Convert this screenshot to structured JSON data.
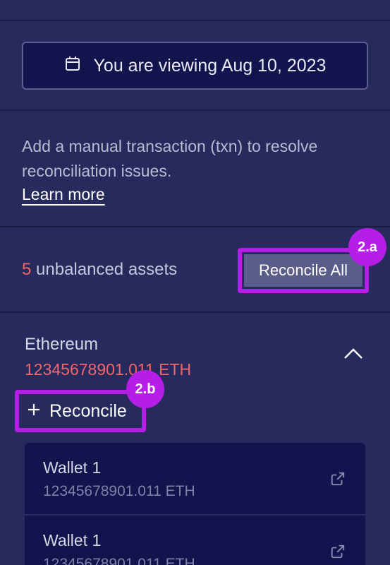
{
  "date_button": {
    "label": "You are viewing Aug 10, 2023"
  },
  "info": {
    "text": "Add a manual transaction (txn) to resolve reconciliation issues.",
    "learn_more": "Learn more"
  },
  "summary": {
    "count": "5",
    "label": "unbalanced assets",
    "reconcile_all": "Reconcile All",
    "badge": "2.a"
  },
  "asset": {
    "name": "Ethereum",
    "amount": "12345678901.011 ETH",
    "reconcile": "Reconcile",
    "badge": "2.b"
  },
  "wallets": [
    {
      "name": "Wallet 1",
      "amount": "12345678901.011 ETH"
    },
    {
      "name": "Wallet 1",
      "amount": "12345678901.011 ETH"
    }
  ],
  "colors": {
    "background": "#272a5c",
    "panel": "#13134e",
    "accent_red": "#f0666b",
    "highlight": "#b41ee6"
  },
  "icons": [
    "calendar-icon",
    "chevron-up-icon",
    "plus-icon",
    "external-link-icon"
  ]
}
